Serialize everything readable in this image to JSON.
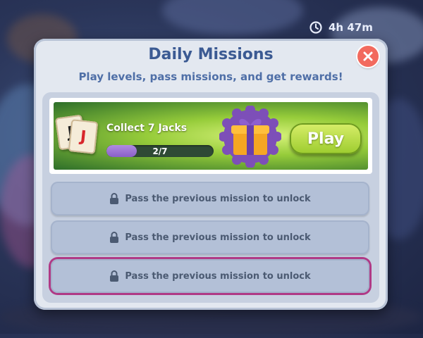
{
  "hud": {
    "timer": "4h 47m",
    "timer_icon": "clock-icon"
  },
  "dialog": {
    "title": "Daily Missions",
    "subtitle": "Play levels, pass missions, and get rewards!",
    "close_icon": "close-icon"
  },
  "missions": {
    "active": {
      "cards": [
        "J",
        "J"
      ],
      "title": "Collect 7 Jacks",
      "progress": {
        "current": 2,
        "total": 7,
        "label": "2/7"
      },
      "reward_icon": "gift-box-icon",
      "play_label": "Play"
    },
    "locked": [
      {
        "label": "Pass the previous mission to unlock"
      },
      {
        "label": "Pass the previous mission to unlock"
      },
      {
        "label": "Pass the previous mission to unlock"
      }
    ]
  },
  "colors": {
    "title": "#3b5a93",
    "close_button": "#f26a5e",
    "play_button": "#9ccc2e",
    "progress_fill": "#8a5fc8",
    "highlight_border": "#b03a86"
  }
}
